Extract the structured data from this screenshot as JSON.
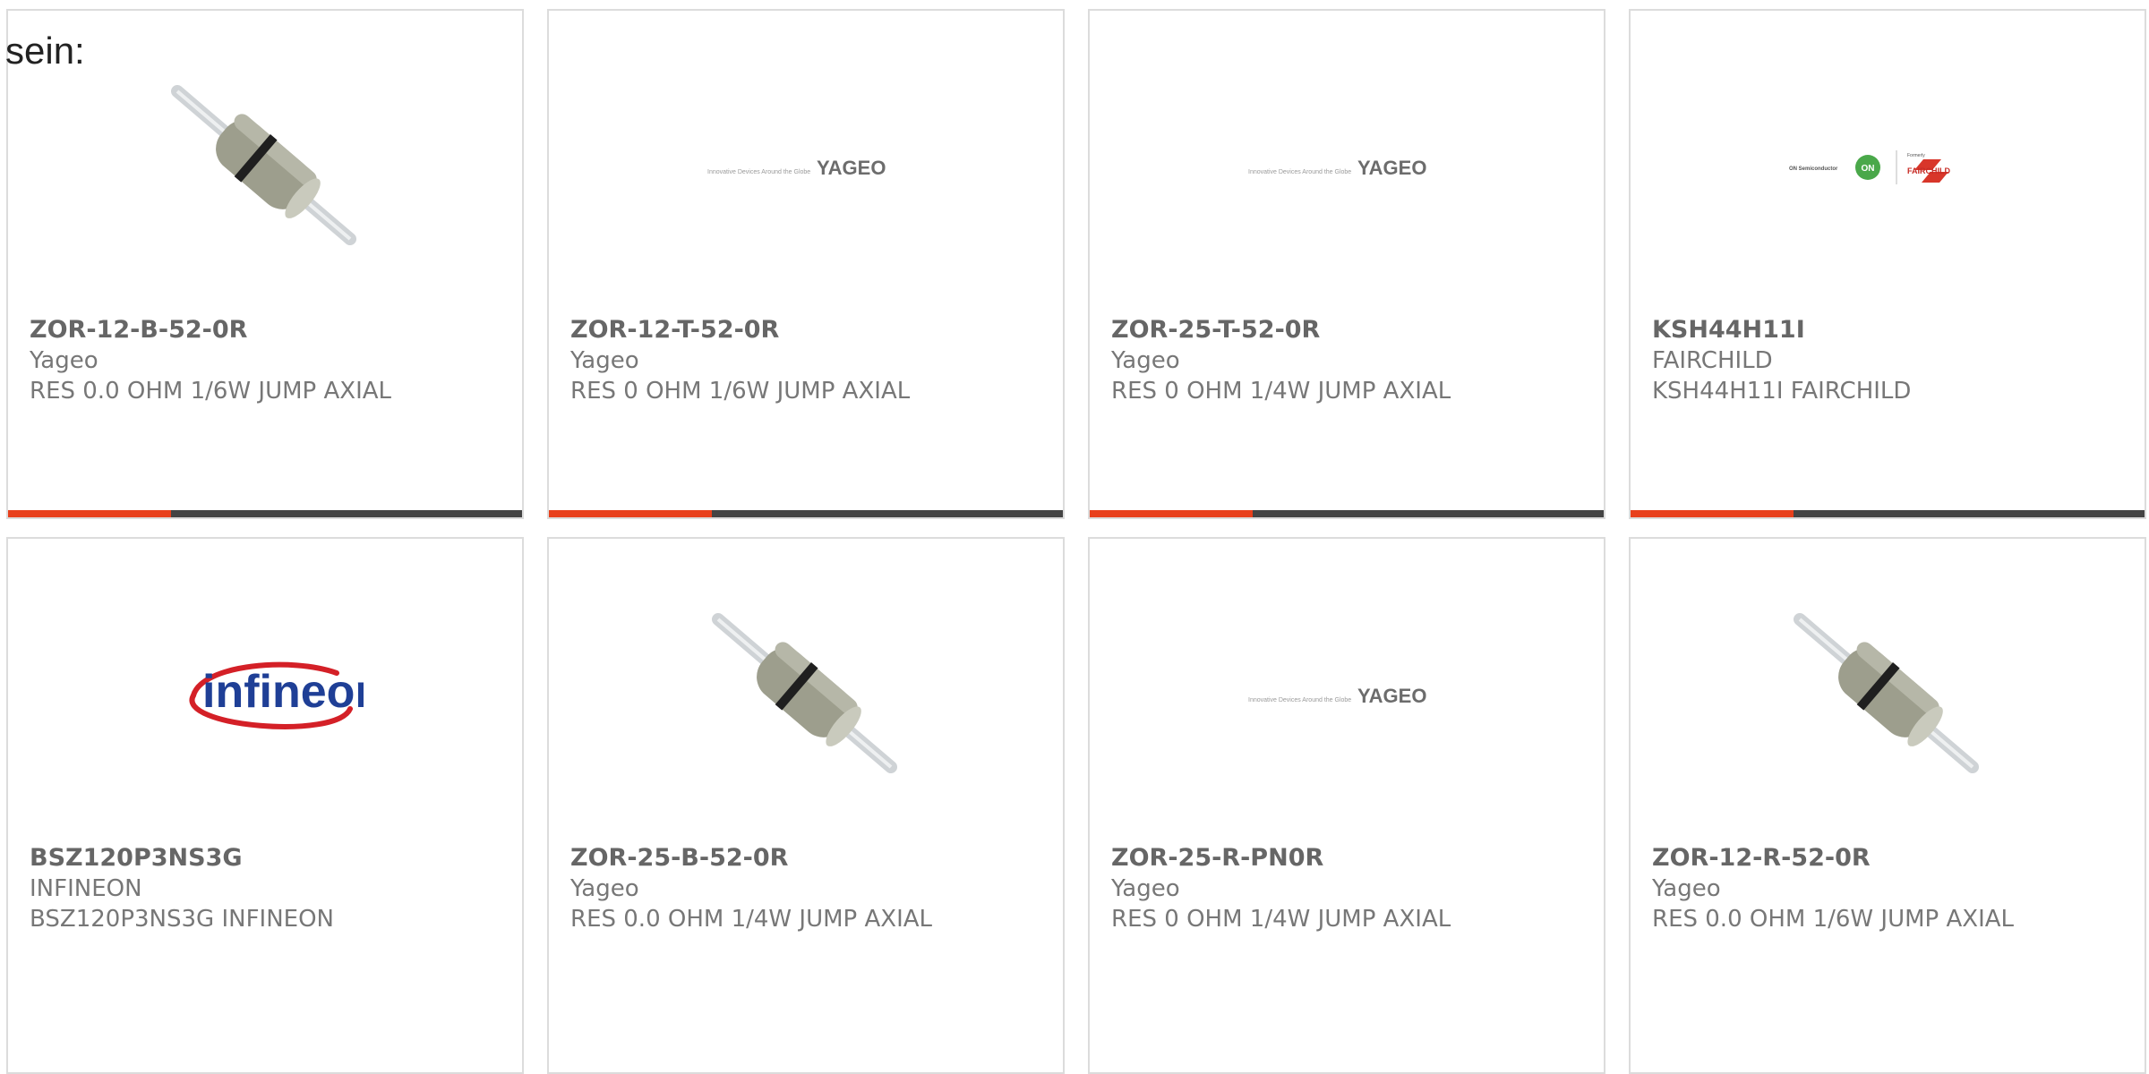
{
  "lead_text": "sein:",
  "colors": {
    "accent": "#e8401c",
    "bar": "#444444",
    "text": "#666666",
    "border": "#dcdcdc"
  },
  "products": [
    {
      "part": "ZOR-12-B-52-0R",
      "maker": "Yageo",
      "description": "RES 0.0 OHM 1/6W JUMP AXIAL",
      "image": "resistor"
    },
    {
      "part": "ZOR-12-T-52-0R",
      "maker": "Yageo",
      "description": "RES 0 OHM 1/6W JUMP AXIAL",
      "image": "yageo-logo"
    },
    {
      "part": "ZOR-25-T-52-0R",
      "maker": "Yageo",
      "description": "RES 0 OHM 1/4W JUMP AXIAL",
      "image": "yageo-logo"
    },
    {
      "part": "KSH44H11I",
      "maker": "FAIRCHILD",
      "description": "KSH44H11I FAIRCHILD",
      "image": "fairchild-logo"
    },
    {
      "part": "BSZ120P3NS3G",
      "maker": "INFINEON",
      "description": "BSZ120P3NS3G INFINEON",
      "image": "infineon-logo"
    },
    {
      "part": "ZOR-25-B-52-0R",
      "maker": "Yageo",
      "description": "RES 0.0 OHM 1/4W JUMP AXIAL",
      "image": "resistor"
    },
    {
      "part": "ZOR-25-R-PN0R",
      "maker": "Yageo",
      "description": "RES 0 OHM 1/4W JUMP AXIAL",
      "image": "yageo-logo"
    },
    {
      "part": "ZOR-12-R-52-0R",
      "maker": "Yageo",
      "description": "RES 0.0 OHM 1/6W JUMP AXIAL",
      "image": "resistor"
    }
  ],
  "logos": {
    "yageo": {
      "tagline": "Innovative Devices Around the Globe",
      "name": "YAGEO"
    },
    "fairchild": {
      "left": "ON Semiconductor",
      "badge": "ON",
      "formerly": "Formerly",
      "name": "FAIRCHILD"
    },
    "infineon": {
      "name": "infineon"
    }
  }
}
